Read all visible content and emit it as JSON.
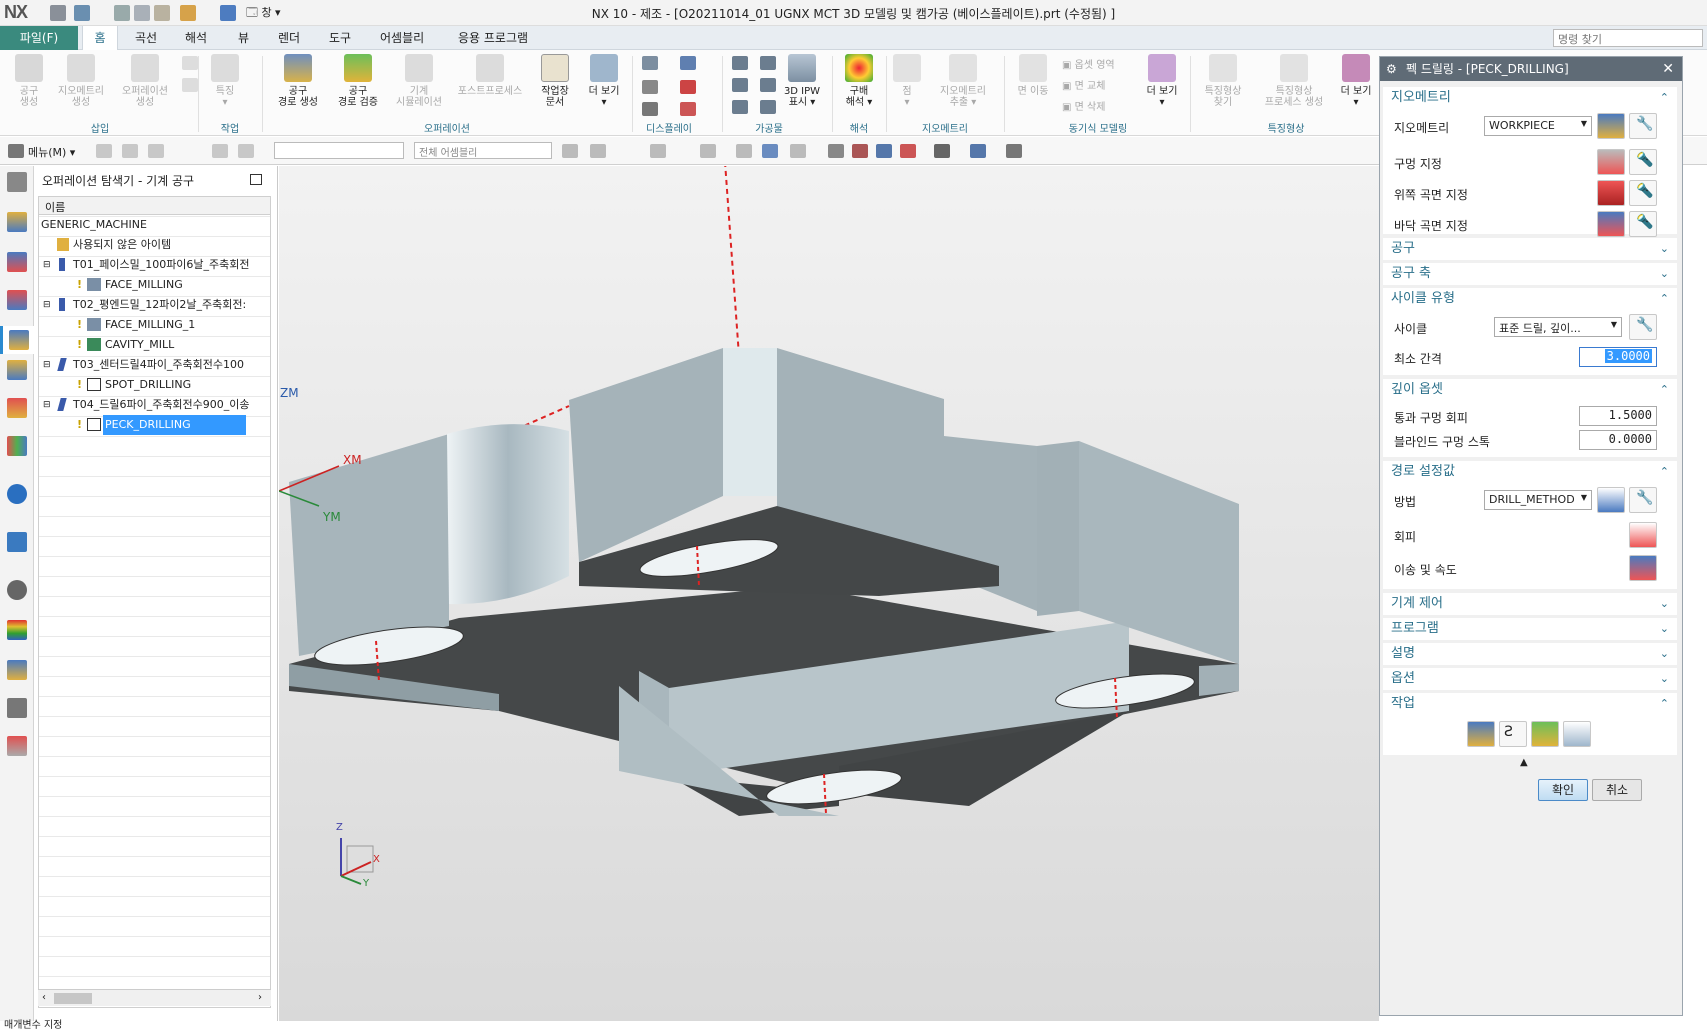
{
  "app": {
    "logo": "NX",
    "title": "NX 10 - 제조 - [O20211014_01 UGNX MCT 3D 모델링 및 캠가공 (베이스플레이트).prt (수정됨) ]",
    "window_menu": "창"
  },
  "menubar": {
    "file": "파일(F)",
    "tabs": [
      "홈",
      "곡선",
      "해석",
      "뷰",
      "렌더",
      "도구",
      "어셈블리",
      "응용 프로그램"
    ],
    "search_placeholder": "명령 찾기"
  },
  "ribbon": {
    "buttons": [
      {
        "label": "공구\n생성",
        "dim": true
      },
      {
        "label": "지오메트리\n생성",
        "dim": true
      },
      {
        "label": "오퍼레이션\n생성",
        "dim": true
      },
      {
        "label": "특징\n▾",
        "dim": true
      },
      {
        "label": "공구\n경로 생성",
        "dim": false
      },
      {
        "label": "공구\n경로 검증",
        "dim": false
      },
      {
        "label": "기계\n시뮬레이션",
        "dim": true
      },
      {
        "label": "포스트프로세스",
        "dim": true
      },
      {
        "label": "작업장\n문서",
        "dim": false
      },
      {
        "label": "더 보기\n▾",
        "dim": false
      },
      {
        "label": "3D IPW\n표시 ▾",
        "dim": false
      },
      {
        "label": "구배\n해석 ▾",
        "dim": false
      },
      {
        "label": "점\n▾",
        "dim": true
      },
      {
        "label": "지오메트리\n추출 ▾",
        "dim": true
      },
      {
        "label": "면 이동",
        "dim": true
      },
      {
        "label": "더 보기\n▾",
        "dim": false
      },
      {
        "label": "특징형상\n찾기",
        "dim": true
      },
      {
        "label": "특징형상\n프로세스 생성",
        "dim": true
      },
      {
        "label": "더 보기\n▾",
        "dim": false
      }
    ],
    "side_items": [
      "옵셋 영역",
      "면 교체",
      "면 삭제"
    ],
    "groups": [
      "삽입",
      "작업",
      "오퍼레이션",
      "디스플레이",
      "가공물",
      "해석",
      "지오메트리",
      "동기식 모델링",
      "특징형상"
    ]
  },
  "toolbar2": {
    "menu": "메뉴(M) ▾",
    "assembly_filter": "전체 어셈블리"
  },
  "navigator": {
    "title": "오퍼레이션 탐색기 - 기계 공구",
    "column": "이름",
    "rows": [
      {
        "label": "GENERIC_MACHINE",
        "level": 0,
        "type": "none"
      },
      {
        "label": "사용되지 않은 아이템",
        "level": 1,
        "type": "folder"
      },
      {
        "label": "T01_페이스밀_100파이6날_주축회전",
        "level": 1,
        "type": "tool"
      },
      {
        "label": "FACE_MILLING",
        "level": 2,
        "type": "op"
      },
      {
        "label": "T02_평엔드밀_12파이2날_주축회전:",
        "level": 1,
        "type": "tool"
      },
      {
        "label": "FACE_MILLING_1",
        "level": 2,
        "type": "op"
      },
      {
        "label": "CAVITY_MILL",
        "level": 2,
        "type": "op"
      },
      {
        "label": "T03_센터드릴4파이_주축회전수100",
        "level": 1,
        "type": "drill"
      },
      {
        "label": "SPOT_DRILLING",
        "level": 2,
        "type": "drillop"
      },
      {
        "label": "T04_드릴6파이_주축회전수900_이송",
        "level": 1,
        "type": "drill"
      },
      {
        "label": "PECK_DRILLING",
        "level": 2,
        "type": "drillop",
        "selected": true
      }
    ]
  },
  "viewport": {
    "axis_labels": {
      "zm": "ZM",
      "xm": "XM",
      "ym": "YM",
      "z": "Z",
      "x": "X",
      "y": "Y"
    }
  },
  "dialog": {
    "title": "펙 드릴링 - [PECK_DRILLING]",
    "geometry": {
      "header": "지오메트리",
      "geometry_label": "지오메트리",
      "geometry_value": "WORKPIECE",
      "hole_label": "구멍 지정",
      "top_label": "위쪽 곡면 지정",
      "bottom_label": "바닥 곡면 지정"
    },
    "collapsed1": [
      "공구",
      "공구 축"
    ],
    "cycle": {
      "header": "사이클 유형",
      "cycle_label": "사이클",
      "cycle_value": "표준 드릴, 깊이...",
      "min_label": "최소 간격",
      "min_value": "3.0000"
    },
    "depth": {
      "header": "깊이 옵셋",
      "through_label": "통과 구멍 회피",
      "through_value": "1.5000",
      "blind_label": "블라인드 구멍 스톡",
      "blind_value": "0.0000"
    },
    "path": {
      "header": "경로 설정값",
      "method_label": "방법",
      "method_value": "DRILL_METHOD",
      "avoid_label": "회피",
      "feeds_label": "이송 및 속도"
    },
    "collapsed2": [
      "기계 제어",
      "프로그램",
      "설명",
      "옵션"
    ],
    "actions": {
      "header": "작업"
    },
    "ok": "확인",
    "cancel": "취소"
  },
  "status": "매개변수 지정"
}
